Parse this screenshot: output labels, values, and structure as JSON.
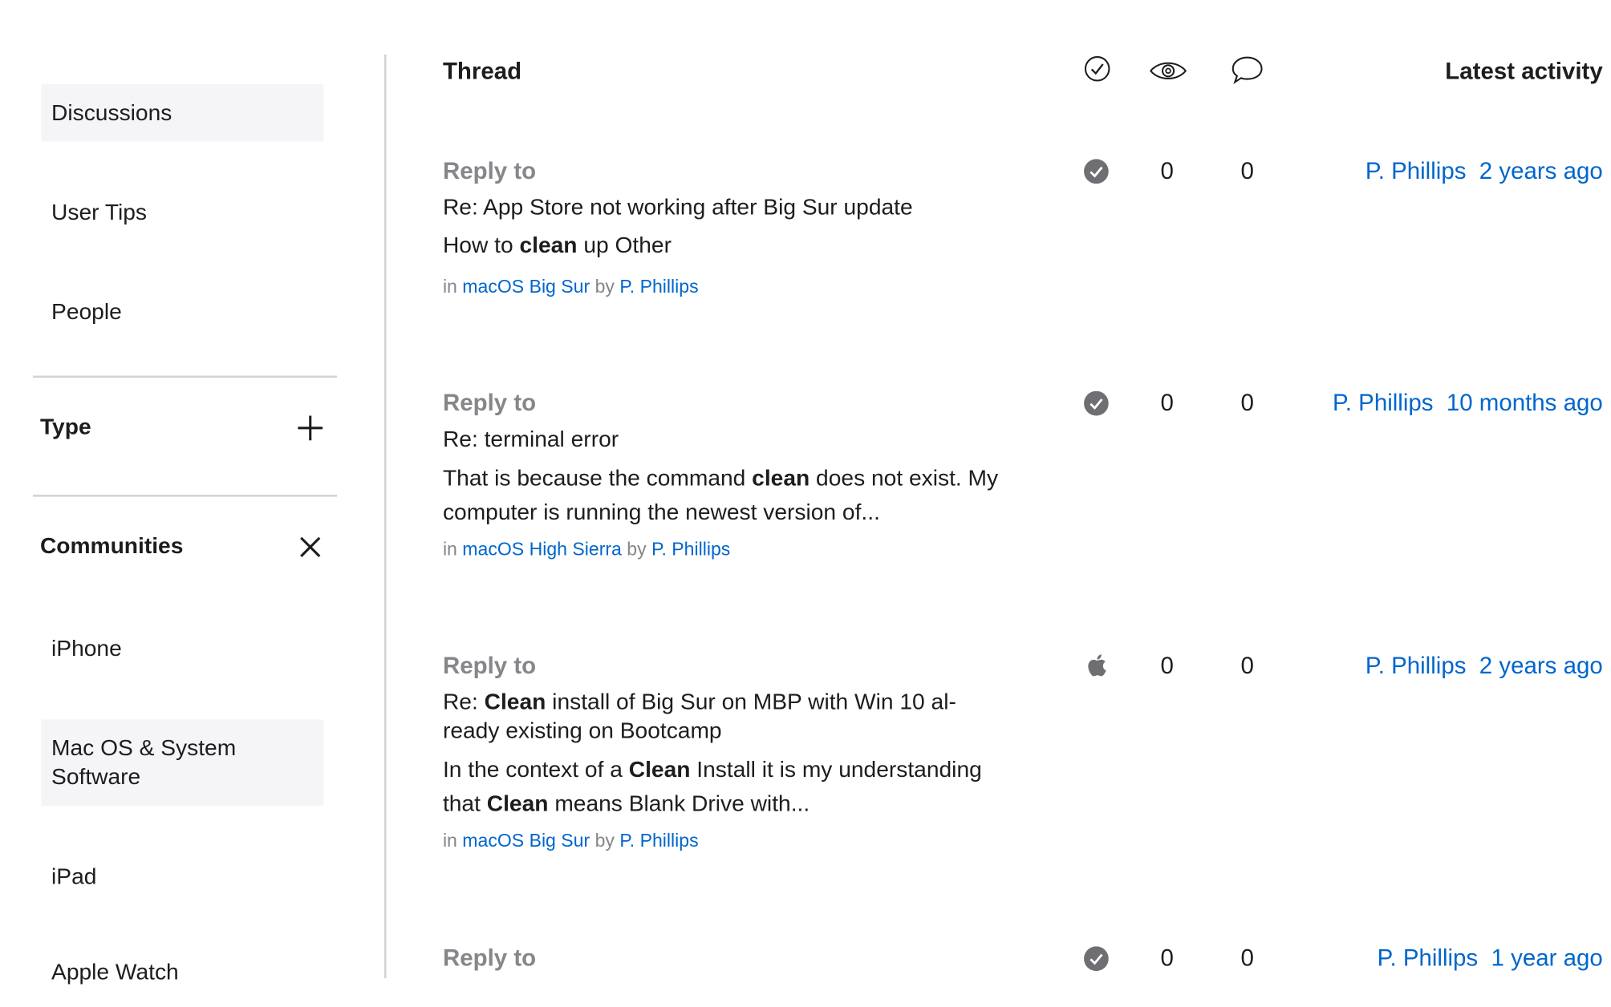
{
  "sidebar": {
    "nav": [
      {
        "label": "Discussions",
        "selected": true
      },
      {
        "label": "User Tips",
        "selected": false
      },
      {
        "label": "People",
        "selected": false
      }
    ],
    "type_section": {
      "title": "Type",
      "icon": "plus-icon"
    },
    "communities_section": {
      "title": "Communities",
      "icon": "close-icon",
      "items": [
        {
          "label": "iPhone"
        },
        {
          "label": "Mac OS & System Software"
        },
        {
          "label": "iPad"
        },
        {
          "label": "Apple Watch"
        }
      ]
    }
  },
  "table": {
    "header": {
      "thread": "Thread",
      "latest": "Latest activity",
      "icons": [
        "checkmark-circle-icon",
        "eye-icon",
        "speech-bubble-icon"
      ]
    },
    "rows": [
      {
        "reply_label": "Reply to",
        "title_pre": "Re: App Store not working after Big Sur update",
        "snippet": [
          "How to ",
          "clean",
          " up Other"
        ],
        "in": "in",
        "community": "macOS Big Sur",
        "by": "by",
        "author": "P. Phillips",
        "status_icon": "solved-check-icon",
        "views": "0",
        "replies": "0",
        "latest_user": "P. Phillips",
        "latest_time": "2 years ago"
      },
      {
        "reply_label": "Reply to",
        "title_pre": "Re: terminal error",
        "snippet": [
          "That is because the command ",
          "clean",
          " does not exist. My computer is running the newest version of..."
        ],
        "in": "in",
        "community": "macOS High Sierra",
        "by": "by",
        "author": "P. Phillips",
        "status_icon": "solved-check-icon",
        "views": "0",
        "replies": "0",
        "latest_user": "P. Phillips",
        "latest_time": "10 months ago"
      },
      {
        "reply_label": "Reply to",
        "title_parts": [
          "Re: ",
          "Clean",
          " install of Big Sur on MBP with Win 10 al-ready existing on Bootcamp"
        ],
        "snippet2": [
          "In the context of a ",
          "Clean",
          " Install it is my understanding that ",
          "Clean",
          " means Blank Drive with..."
        ],
        "in": "in",
        "community": "macOS Big Sur",
        "by": "by",
        "author": "P. Phillips",
        "status_icon": "apple-icon",
        "views": "0",
        "replies": "0",
        "latest_user": "P. Phillips",
        "latest_time": "2 years ago"
      },
      {
        "reply_label": "Reply to",
        "status_icon": "solved-check-icon",
        "views": "0",
        "replies": "0",
        "latest_user": "P. Phillips",
        "latest_time": "1 year ago"
      }
    ]
  }
}
